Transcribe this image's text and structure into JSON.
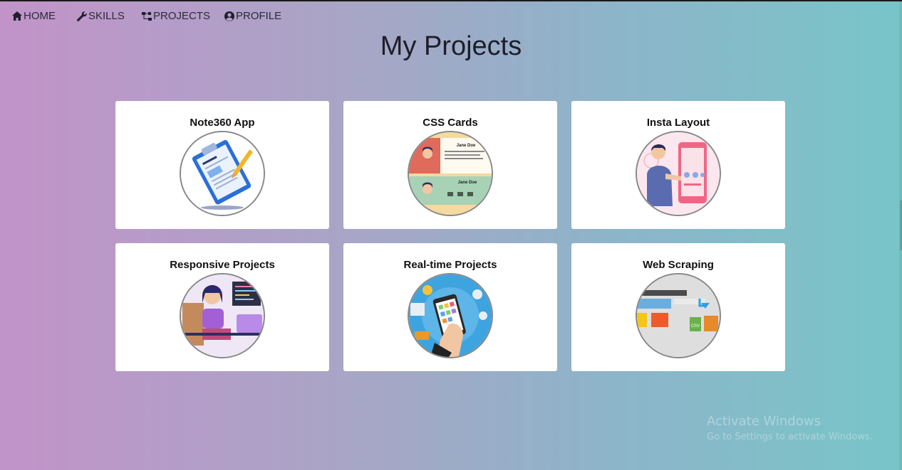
{
  "nav": {
    "home": {
      "label": "HOME",
      "icon": "home-icon"
    },
    "skills": {
      "label": "SKILLS",
      "icon": "wrench-icon"
    },
    "projects": {
      "label": "PROJECTS",
      "icon": "sitemap-icon"
    },
    "profile": {
      "label": "PROFILE",
      "icon": "user-circle-icon"
    }
  },
  "page_title": "My Projects",
  "projects": [
    {
      "title": "Note360 App",
      "image": "clipboard-notes-illustration"
    },
    {
      "title": "CSS Cards",
      "image": "profile-cards-illustration",
      "card_name_1": "Jane Doe",
      "card_name_2": "Jane Doe"
    },
    {
      "title": "Insta Layout",
      "image": "person-with-phone-illustration"
    },
    {
      "title": "Responsive Projects",
      "image": "girl-at-laptop-illustration"
    },
    {
      "title": "Real-time Projects",
      "image": "hand-holding-phone-illustration"
    },
    {
      "title": "Web Scraping",
      "image": "web-to-csv-illustration",
      "csv_label": "CSV"
    }
  ],
  "watermark": {
    "line1": "Activate Windows",
    "line2": "Go to Settings to activate Windows."
  },
  "colors": {
    "gradient_left": "#c293c9",
    "gradient_right": "#78c5c8",
    "card_bg": "#ffffff"
  }
}
